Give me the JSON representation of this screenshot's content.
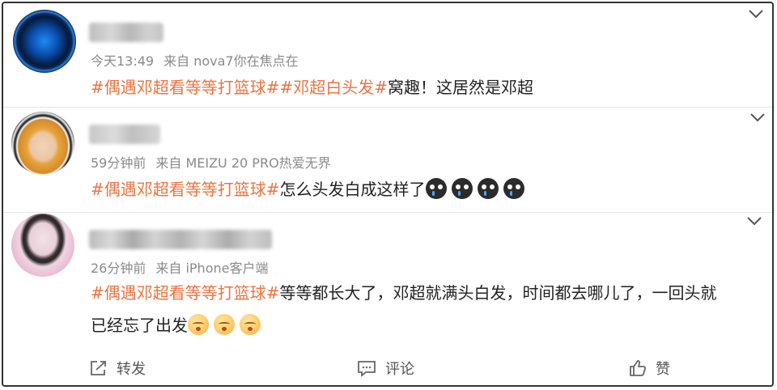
{
  "comments": [
    {
      "time": "今天13:49",
      "source": "来自 nova7你在焦点在",
      "hashtags": [
        "#偶遇邓超看等等打篮球#",
        "#邓超白头发#"
      ],
      "text": "窝趣！这居然是邓超",
      "text_cont": "",
      "emojis": [],
      "emojis_cont": []
    },
    {
      "time": "59分钟前",
      "source": "来自 MEIZU 20 PRO热爱无界",
      "hashtags": [
        "#偶遇邓超看等等打篮球#"
      ],
      "text": "怎么头发白成这样了",
      "text_cont": "",
      "emojis": [
        "crying-face",
        "crying-face",
        "crying-face",
        "crying-face"
      ],
      "emojis_cont": []
    },
    {
      "time": "26分钟前",
      "source": "来自 iPhone客户端",
      "hashtags": [
        "#偶遇邓超看等等打篮球#"
      ],
      "text": "等等都长大了，邓超就满头白发，时间都去哪儿了，一回头就",
      "text_cont": "已经忘了出发",
      "emojis": [],
      "emojis_cont": [
        "sad-face",
        "sad-face",
        "sad-face"
      ]
    }
  ],
  "actions": {
    "repost_label": "转发",
    "comment_label": "评论",
    "like_label": "赞"
  },
  "colors": {
    "hashtag": "#eb7340",
    "meta": "#8a8a8a",
    "text": "#222222"
  }
}
